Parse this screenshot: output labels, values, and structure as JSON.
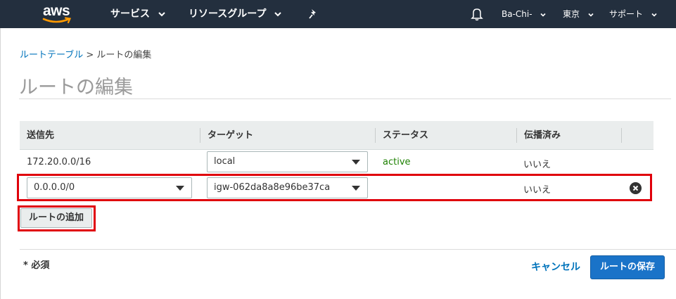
{
  "nav": {
    "logo": "aws",
    "services": "サービス",
    "resource_groups": "リソースグループ",
    "account": "Ba-Chi-",
    "region": "東京",
    "support": "サポート"
  },
  "breadcrumb": {
    "parent": "ルートテーブル",
    "separator": ">",
    "current": "ルートの編集"
  },
  "page_title": "ルートの編集",
  "table": {
    "headers": [
      "送信先",
      "ターゲット",
      "ステータス",
      "伝播済み"
    ],
    "rows": [
      {
        "destination": "172.20.0.0/16",
        "target": "local",
        "status": "active",
        "propagated": "いいえ"
      },
      {
        "destination": "0.0.0.0/0",
        "target": "igw-062da8a8e96be37ca",
        "status": "",
        "propagated": "いいえ"
      }
    ]
  },
  "add_route_button": "ルートの追加",
  "required_note": "* 必須",
  "cancel": "キャンセル",
  "save": "ルートの保存",
  "colors": {
    "nav_bg": "#232f3e",
    "link": "#0073bb",
    "active": "#1d8102",
    "primary_button": "#1a73c8",
    "highlight": "#e0000b"
  }
}
